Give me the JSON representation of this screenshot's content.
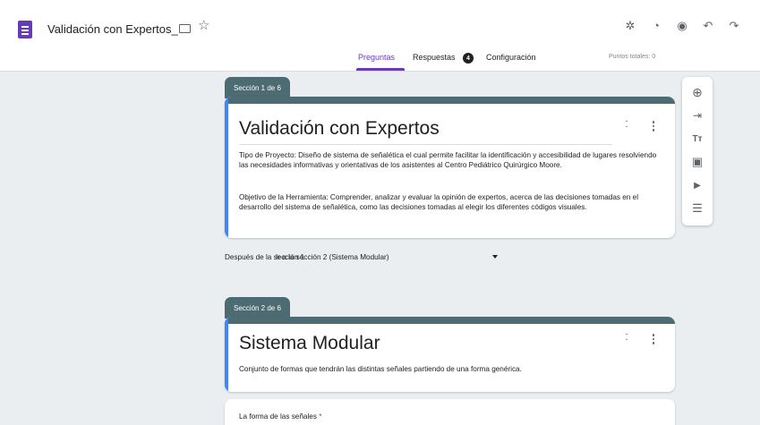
{
  "header": {
    "doc_title": "Validación con Expertos_",
    "star_glyph": "☆",
    "right_icons": [
      {
        "name": "addon-puzzle-icon",
        "glyph": "✲"
      },
      {
        "name": "palette-icon",
        "glyph": "◔"
      },
      {
        "name": "preview-eye-icon",
        "glyph": "◉"
      },
      {
        "name": "undo-icon",
        "glyph": "↶"
      },
      {
        "name": "redo-icon",
        "glyph": "↷"
      }
    ]
  },
  "tabs": {
    "questions": "Preguntas",
    "responses": "Respuestas",
    "responses_count": "4",
    "settings": "Configuración",
    "points_total": "Puntos totales: 0"
  },
  "sections": [
    {
      "tab_label": "Sección 1 de 6",
      "title": "Validación con Expertos",
      "description_1": "Tipo de Proyecto: Diseño de sistema de señalética el cual permite facilitar la identificación y accesibilidad de lugares resolviendo las necesidades informativas y orientativas de los asistentes al Centro Pediátrico Quirúrgico Moore.",
      "description_2": "Objetivo de la Herramienta: Comprender, analizar y evaluar la opinión de expertos, acerca de las decisiones tomadas en el desarrollo del sistema de señalética, como las decisiones tomadas al elegir los diferentes códigos visuales."
    },
    {
      "tab_label": "Sección 2 de 6",
      "title": "Sistema Modular",
      "description_1": "Conjunto de formas que tendrán las distintas señales partiendo de una forma genérica."
    }
  ],
  "section_nav": {
    "after_label": "Después de la sección 1",
    "goto_value": "Ir a la sección 2 (Sistema Modular)"
  },
  "toolbar": [
    {
      "name": "add-question-icon",
      "glyph": "⊕"
    },
    {
      "name": "import-questions-icon",
      "glyph": "⇥"
    },
    {
      "name": "add-title-icon",
      "glyph": "Tт"
    },
    {
      "name": "add-image-icon",
      "glyph": "▣"
    },
    {
      "name": "add-video-icon",
      "glyph": "▶"
    },
    {
      "name": "add-section-icon",
      "glyph": "☰"
    }
  ],
  "question": {
    "label": "La forma de las señales",
    "required_mark": "*"
  },
  "colors": {
    "accent": "#673ab7",
    "section_header": "#4c6b73",
    "focus_bar": "#4285f4",
    "background": "#ebeef1"
  }
}
